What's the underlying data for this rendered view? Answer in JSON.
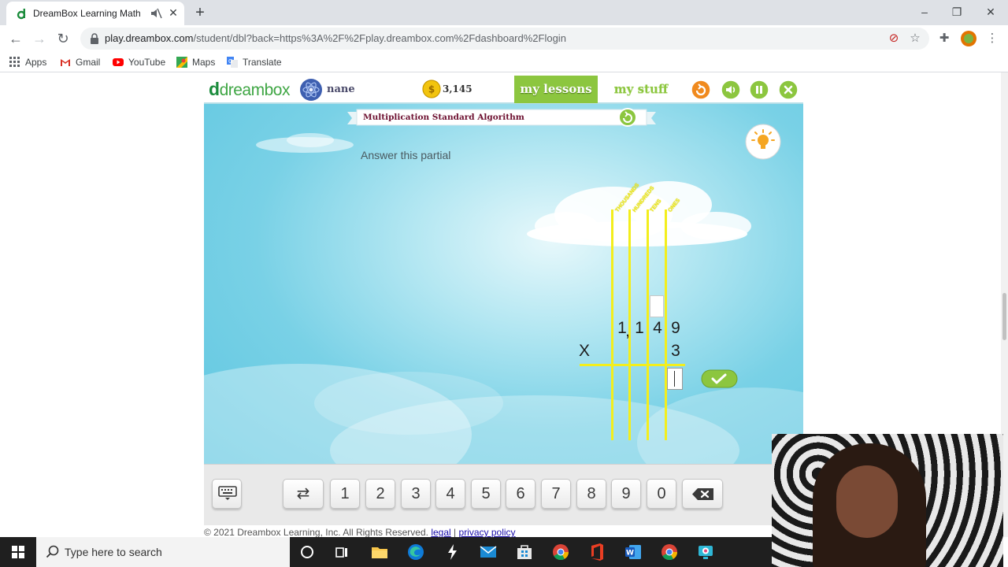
{
  "browser": {
    "tab_title": "DreamBox Learning Math",
    "tab_close": "✕",
    "new_tab": "+",
    "url_host": "play.dreambox.com",
    "url_path": "/student/dbl?back=https%3A%2F%2Fplay.dreambox.com%2Fdashboard%2Flogin",
    "bookmarks": [
      "Apps",
      "Gmail",
      "YouTube",
      "Maps",
      "Translate"
    ]
  },
  "app": {
    "logo_d": "d",
    "logo_text": "dreambox",
    "username": "nane",
    "coins": "3,145",
    "nav": {
      "my_lessons": "my lessons",
      "my_stuff": "my stuff"
    },
    "lesson_title": "Multiplication Standard Algorithm",
    "prompt": "Answer this partial",
    "place_values": [
      "THOUSANDS",
      "HUNDREDS",
      "TENS",
      "ONES"
    ],
    "problem": {
      "top_digits": [
        "1",
        ",",
        "1",
        "4",
        "9"
      ],
      "operator": "X",
      "multiplier": "3"
    },
    "keypad": [
      "1",
      "2",
      "3",
      "4",
      "5",
      "6",
      "7",
      "8",
      "9",
      "0"
    ]
  },
  "footer": {
    "copyright": "© 2021 Dreambox Learning, Inc. All Rights Reserved.",
    "legal": "legal",
    "separator": "|",
    "privacy": "privacy policy"
  },
  "taskbar": {
    "search_placeholder": "Type here to search"
  },
  "colors": {
    "brand_green": "#8cc63f",
    "place_value_yellow": "#f3ee1c",
    "banner_text": "#6d1030"
  }
}
